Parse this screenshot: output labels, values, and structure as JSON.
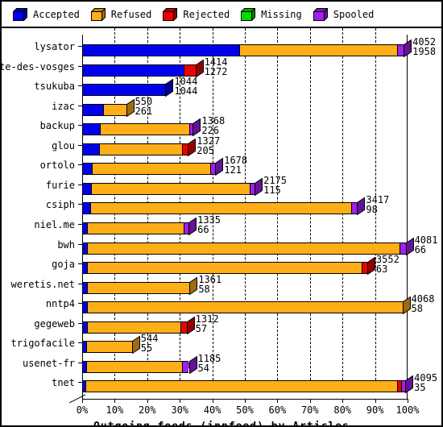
{
  "legend": {
    "items": [
      {
        "label": "Accepted",
        "color": "#0000ee",
        "icon": "cube-icon"
      },
      {
        "label": "Refused",
        "color": "#ffae17",
        "icon": "cube-icon"
      },
      {
        "label": "Rejected",
        "color": "#ee0000",
        "icon": "cube-icon"
      },
      {
        "label": "Missing",
        "color": "#00dd00",
        "icon": "cube-icon"
      },
      {
        "label": "Spooled",
        "color": "#a020f0",
        "icon": "cube-icon"
      }
    ]
  },
  "chart_data": {
    "type": "bar",
    "orientation": "horizontal",
    "stacked": true,
    "title": "",
    "xlabel": "Outgoing feeds (innfeed) by Articles",
    "ylabel": "",
    "xlim": [
      0,
      100
    ],
    "xunit": "%",
    "grid": true,
    "legend_position": "top",
    "xticks": [
      "0%",
      "10%",
      "20%",
      "30%",
      "40%",
      "50%",
      "60%",
      "70%",
      "80%",
      "90%",
      "100%"
    ],
    "xtick_values": [
      0,
      10,
      20,
      30,
      40,
      50,
      60,
      70,
      80,
      90,
      100
    ],
    "series_names": [
      "Accepted",
      "Refused",
      "Rejected",
      "Missing",
      "Spooled"
    ],
    "series_colors": [
      "#0000ee",
      "#ffae17",
      "#ee0000",
      "#00dd00",
      "#a020f0"
    ],
    "categories": [
      "lysator",
      "bete-des-vosges",
      "tsukuba",
      "izac",
      "backup",
      "glou",
      "ortolo",
      "furie",
      "csiph",
      "niel.me",
      "bwh",
      "goja",
      "weretis.net",
      "nntp4",
      "gegeweb",
      "trigofacile",
      "usenet-fr",
      "tnet"
    ],
    "rows": [
      {
        "category": "lysator",
        "total": 4052,
        "accepted": 1958,
        "label_top": "4052",
        "label_bottom": "1958",
        "pct": [
          48.3,
          48.5,
          0,
          0,
          2.0
        ]
      },
      {
        "category": "bete-des-vosges",
        "total": 1414,
        "accepted": 1272,
        "label_top": "1414",
        "label_bottom": "1272",
        "pct": [
          31.3,
          0,
          3.5,
          0,
          0
        ]
      },
      {
        "category": "tsukuba",
        "total": 1044,
        "accepted": 1044,
        "label_top": "1044",
        "label_bottom": "1044",
        "pct": [
          25.6,
          0,
          0,
          0,
          0
        ]
      },
      {
        "category": "izac",
        "total": 550,
        "accepted": 261,
        "label_top": "550",
        "label_bottom": "261",
        "pct": [
          6.4,
          7.1,
          0,
          0,
          0
        ]
      },
      {
        "category": "backup",
        "total": 1368,
        "accepted": 226,
        "label_top": "1368",
        "label_bottom": "226",
        "pct": [
          5.5,
          27.5,
          0,
          0,
          1.0
        ]
      },
      {
        "category": "glou",
        "total": 1327,
        "accepted": 205,
        "label_top": "1327",
        "label_bottom": "205",
        "pct": [
          5.1,
          25.7,
          1.7,
          0,
          0
        ]
      },
      {
        "category": "ortolo",
        "total": 1678,
        "accepted": 121,
        "label_top": "1678",
        "label_bottom": "121",
        "pct": [
          3.0,
          36.4,
          0,
          0,
          1.5
        ]
      },
      {
        "category": "furie",
        "total": 2175,
        "accepted": 115,
        "label_top": "2175",
        "label_bottom": "115",
        "pct": [
          2.8,
          48.7,
          0,
          0,
          1.5
        ]
      },
      {
        "category": "csiph",
        "total": 3417,
        "accepted": 98,
        "label_top": "3417",
        "label_bottom": "98",
        "pct": [
          2.4,
          80.2,
          0,
          0,
          1.9
        ]
      },
      {
        "category": "niel.me",
        "total": 1335,
        "accepted": 66,
        "label_top": "1335",
        "label_bottom": "66",
        "pct": [
          1.6,
          29.5,
          0,
          0,
          1.6
        ]
      },
      {
        "category": "bwh",
        "total": 4081,
        "accepted": 66,
        "label_top": "4081",
        "label_bottom": "66",
        "pct": [
          1.6,
          96.0,
          0,
          0,
          1.8
        ]
      },
      {
        "category": "goja",
        "total": 3552,
        "accepted": 63,
        "label_top": "3552",
        "label_bottom": "63",
        "pct": [
          1.5,
          84.3,
          1.8,
          0,
          0
        ]
      },
      {
        "category": "weretis.net",
        "total": 1361,
        "accepted": 58,
        "label_top": "1361",
        "label_bottom": "58",
        "pct": [
          1.4,
          31.6,
          0,
          0,
          0
        ]
      },
      {
        "category": "nntp4",
        "total": 4068,
        "accepted": 58,
        "label_top": "4068",
        "label_bottom": "58",
        "pct": [
          1.4,
          97.0,
          0,
          0,
          0
        ]
      },
      {
        "category": "gegeweb",
        "total": 1312,
        "accepted": 57,
        "label_top": "1312",
        "label_bottom": "57",
        "pct": [
          1.4,
          28.8,
          1.9,
          0,
          0
        ]
      },
      {
        "category": "trigofacile",
        "total": 544,
        "accepted": 55,
        "label_top": "544",
        "label_bottom": "55",
        "pct": [
          1.3,
          14.0,
          0,
          0,
          0
        ]
      },
      {
        "category": "usenet-fr",
        "total": 1185,
        "accepted": 54,
        "label_top": "1185",
        "label_bottom": "54",
        "pct": [
          1.3,
          29.3,
          0,
          0,
          2.2
        ]
      },
      {
        "category": "tnet",
        "total": 4095,
        "accepted": 35,
        "label_top": "4095",
        "label_bottom": "35",
        "pct": [
          0.9,
          95.8,
          1.2,
          0,
          1.4
        ]
      }
    ]
  }
}
